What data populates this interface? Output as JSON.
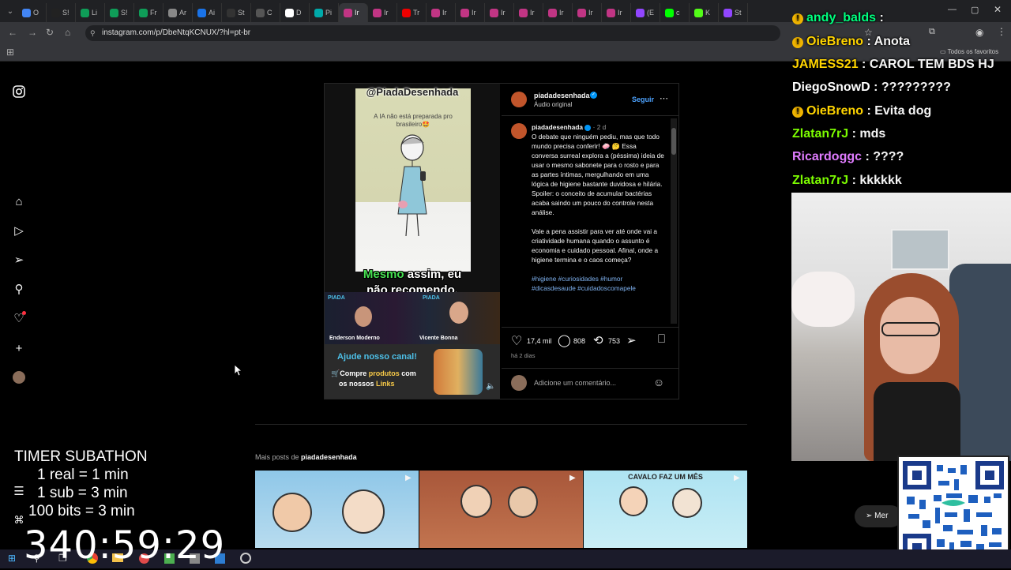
{
  "browser": {
    "tabs": [
      {
        "label": "O",
        "color": "#4285f4"
      },
      {
        "label": "S!",
        "color": "#222"
      },
      {
        "label": "Li",
        "color": "#0f9d58"
      },
      {
        "label": "S!",
        "color": "#0f9d58"
      },
      {
        "label": "Fr",
        "color": "#0f9d58"
      },
      {
        "label": "Ar",
        "color": "#888"
      },
      {
        "label": "Ai",
        "color": "#1a73e8"
      },
      {
        "label": "St",
        "color": "#333"
      },
      {
        "label": "C",
        "color": "#555"
      },
      {
        "label": "D",
        "color": "#fff"
      },
      {
        "label": "Pi",
        "color": "#0aa"
      },
      {
        "label": "Ir",
        "color": "#c13584"
      },
      {
        "label": "Ir",
        "color": "#c13584"
      },
      {
        "label": "Tr",
        "color": "#e00"
      },
      {
        "label": "Ir",
        "color": "#c13584"
      },
      {
        "label": "Ir",
        "color": "#c13584"
      },
      {
        "label": "Ir",
        "color": "#c13584"
      },
      {
        "label": "Ir",
        "color": "#c13584"
      },
      {
        "label": "Ir",
        "color": "#c13584"
      },
      {
        "label": "Ir",
        "color": "#c13584"
      },
      {
        "label": "Ir",
        "color": "#c13584"
      },
      {
        "label": "(E",
        "color": "#9146ff"
      },
      {
        "label": "c",
        "color": "#0f0"
      },
      {
        "label": "K",
        "color": "#53fc18"
      },
      {
        "label": "St",
        "color": "#9146ff"
      }
    ],
    "url": "instagram.com/p/DbeNtqKCNUX/?hl=pt-br",
    "bookmarks_label": "Todos os favoritos"
  },
  "post": {
    "author": "piadadesenhada",
    "audio": "Áudio original",
    "follow_label": "Seguir",
    "time_ago": "2 d",
    "caption_p1": "O debate que ninguém pediu, mas que todo mundo precisa conferir! 🧼 🤔 Essa conversa surreal explora a (péssima) ideia de usar o mesmo sabonete para o rosto e para as partes íntimas, mergulhando em uma lógica de higiene bastante duvidosa e hilária. Spoiler: o conceito de acumular bactérias acaba saindo um pouco do controle nesta análise.",
    "caption_p2": "Vale a pena assistir para ver até onde vai a criatividade humana quando o assunto é economia e cuidado pessoal. Afinal, onde a higiene termina e o caos começa?",
    "hashtags": "#higiene #curiosidades #humor #dicasdesaude #cuidadoscomapele",
    "likes": "17,4 mil",
    "comments": "808",
    "shares": "753",
    "posted": "há 2 dias",
    "comment_placeholder": "Adicione um comentário...",
    "more_posts_prefix": "Mais posts de",
    "more_posts_author": "piadadesenhada"
  },
  "video": {
    "handle": "@PiadaDesenhada",
    "top_text": "A IA não está preparada pro brasileiro🤩",
    "subtitle_green": "Mesmo",
    "subtitle_rest": " assim, eu",
    "subtitle_line2": "não recomendo.",
    "host_left": "Enderson Moderno",
    "host_right": "Vicente Bonna",
    "support_title": "Ajude nosso canal!",
    "support_line1_a": "Compre ",
    "support_line1_b": "produtos",
    "support_line1_c": " com",
    "support_line2_a": "os nossos ",
    "support_line2_b": "Links"
  },
  "thumbnails": [
    {
      "caption": ""
    },
    {
      "caption": ""
    },
    {
      "caption": "CAVALO FAZ UM MÊS"
    }
  ],
  "chat": [
    {
      "user": "andy_balds",
      "msg": "",
      "color": "#00ff7f",
      "badge": true
    },
    {
      "user": "OieBreno",
      "msg": "Anota",
      "color": "#ffd400",
      "badge": true
    },
    {
      "user": "JAMESS21",
      "msg": "CAROL TEM BDS HJ",
      "color": "#ffd400",
      "badge": false
    },
    {
      "user": "DiegoSnowD",
      "msg": "?????????",
      "color": "#ffffff",
      "badge": false
    },
    {
      "user": "OieBreno",
      "msg": "Evita dog",
      "color": "#ffd400",
      "badge": true
    },
    {
      "user": "Zlatan7rJ",
      "msg": "mds",
      "color": "#7cfc00",
      "badge": false
    },
    {
      "user": "Ricardoggc",
      "msg": "????",
      "color": "#e07cff",
      "badge": false
    },
    {
      "user": "Zlatan7rJ",
      "msg": "kkkkkk",
      "color": "#7cfc00",
      "badge": false
    }
  ],
  "timer": {
    "title": "TIMER SUBATHON",
    "rule1": "1 real = 1 min",
    "rule2": "1 sub = 3 min",
    "rule3": "100 bits = 3 min",
    "countdown": "340:59:29"
  },
  "more_button": "Mer"
}
